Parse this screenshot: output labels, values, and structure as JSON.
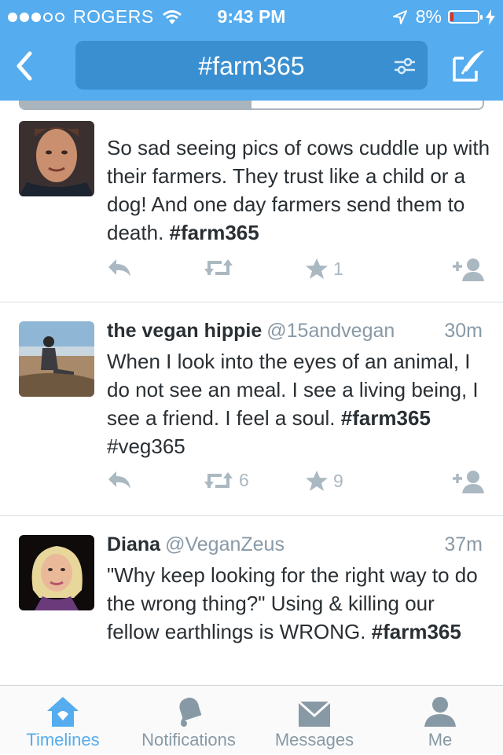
{
  "status_bar": {
    "carrier": "ROGERS",
    "time": "9:43 PM",
    "battery": "8%"
  },
  "header": {
    "search_query": "#farm365"
  },
  "progress": {
    "loaded_fraction": 0.5
  },
  "colors": {
    "accent": "#55acee",
    "header_pill": "#3a8fd1",
    "muted": "#8899a6",
    "action_gray": "#aab8c2",
    "battery_low": "#e0301e"
  },
  "tweets": [
    {
      "name": "",
      "handle": "",
      "time": "",
      "text_parts": [
        "So sad seeing pics of cows cuddle up with their farmers. They trust like a child or a dog! And one day farmers send them to death. ",
        "#farm365",
        ""
      ],
      "retweets": "",
      "favorites": "1"
    },
    {
      "name": "the vegan hippie",
      "handle": "@15andvegan",
      "time": "30m",
      "text_parts": [
        "When I look into the eyes of an animal, I do not see an meal. I see a living being, I see a friend. I feel a soul. ",
        "#farm365",
        " #veg365"
      ],
      "retweets": "6",
      "favorites": "9"
    },
    {
      "name": "Diana",
      "handle": "@VeganZeus",
      "time": "37m",
      "text_parts": [
        "\"Why keep looking for the right way to do the wrong thing?\" Using & killing our fellow earthlings is WRONG. ",
        "#farm365",
        ""
      ],
      "retweets": "",
      "favorites": ""
    }
  ],
  "tabs": [
    {
      "label": "Timelines",
      "icon": "home-icon",
      "active": true
    },
    {
      "label": "Notifications",
      "icon": "bell-icon",
      "active": false
    },
    {
      "label": "Messages",
      "icon": "envelope-icon",
      "active": false
    },
    {
      "label": "Me",
      "icon": "person-icon",
      "active": false
    }
  ]
}
